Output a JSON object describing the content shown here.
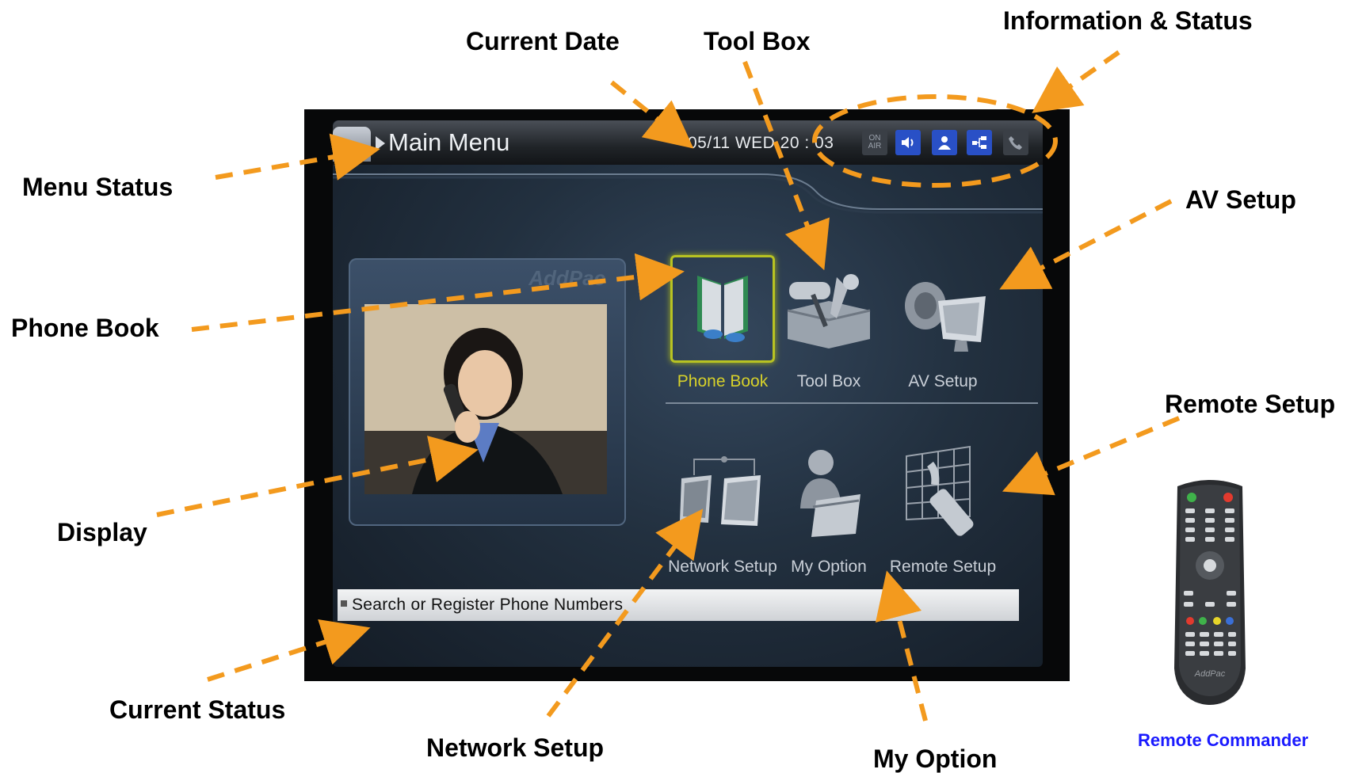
{
  "callouts": {
    "current_date": "Current Date",
    "tool_box": "Tool Box",
    "info_status": "Information & Status",
    "menu_status": "Menu Status",
    "av_setup": "AV Setup",
    "phone_book": "Phone Book",
    "remote_setup": "Remote Setup",
    "display": "Display",
    "current_status": "Current Status",
    "network_setup": "Network Setup",
    "my_option": "My Option",
    "remote_commander": "Remote Commander"
  },
  "screen": {
    "menu_title": "Main Menu",
    "date": "05/11  WED  20 : 03",
    "status_icons": [
      "on-air-icon",
      "speaker-icon",
      "user-icon",
      "network-icon",
      "phone-icon"
    ],
    "onair_text": "ON AIR",
    "brand": "AddPac",
    "menu_items": [
      {
        "label": "Phone Book",
        "icon": "phone-book-icon"
      },
      {
        "label": "Tool Box",
        "icon": "tool-box-icon"
      },
      {
        "label": "AV Setup",
        "icon": "av-setup-icon"
      },
      {
        "label": "Network Setup",
        "icon": "network-setup-icon"
      },
      {
        "label": "My Option",
        "icon": "my-option-icon"
      },
      {
        "label": "Remote Setup",
        "icon": "remote-setup-icon"
      }
    ],
    "status_text": "Search or Register Phone Numbers"
  },
  "remote_brand": "AddPac",
  "colors": {
    "arrow": "#f39a1e",
    "highlight": "#d7d12a",
    "status_icon_blue": "#2950c6",
    "caption_blue": "#1a1aff"
  }
}
